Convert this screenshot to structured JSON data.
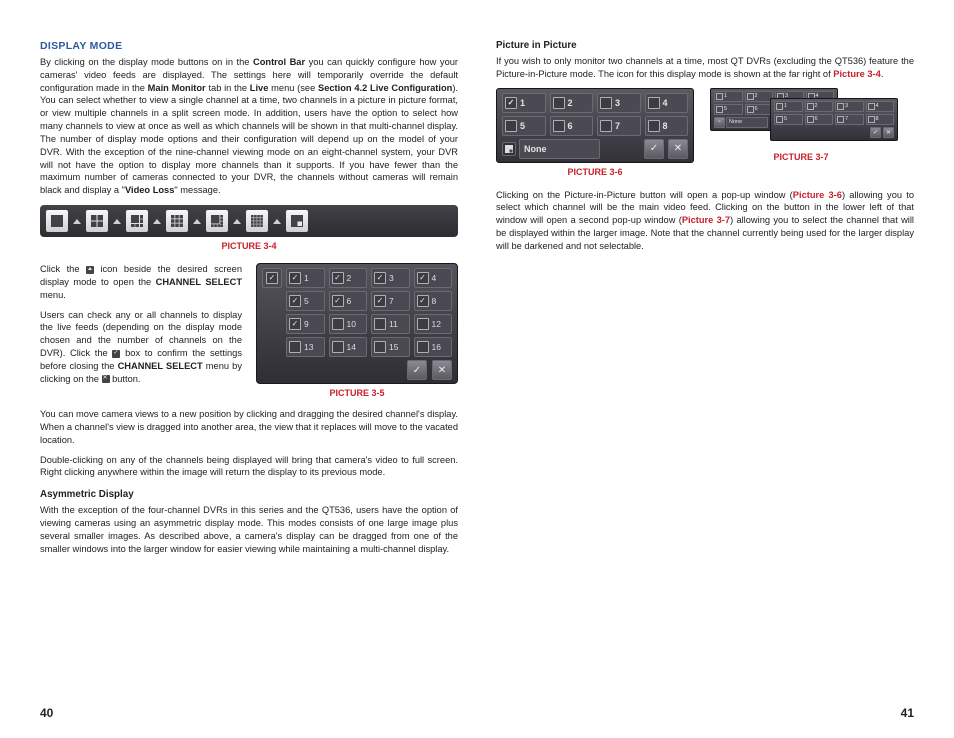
{
  "left": {
    "h1": "DISPLAY MODE",
    "p1a": "By clicking on the display mode buttons on in the ",
    "p1b": "Control Bar",
    "p1c": " you can quickly configure how your cameras' video feeds are displayed. The settings here will temporarily override the default configuration made in the ",
    "p1d": "Main Monitor",
    "p1e": " tab in the ",
    "p1f": "Live",
    "p1g": " menu (see ",
    "p1h": "Section 4.2 Live Configuration",
    "p1i": "). You can select whether to view a single channel at a time, two channels in a picture in picture format, or view multiple channels in a split screen mode. In addition, users have the option to select how many channels to view at once as well as which channels will be shown in that multi-channel display. The number of display mode options and their configuration will depend up on the model of your DVR. With the exception of the nine-channel viewing mode on an eight-channel system, your DVR will not have the option to display more channels than it supports. If you have fewer than the maximum number of cameras connected to your DVR, the channels without cameras will remain black and display a \"",
    "p1j": "Video Loss",
    "p1k": "\" message.",
    "pic34": "PICTURE 3-4",
    "p2a": "Click the ",
    "p2b": " icon beside the desired screen display mode to open the ",
    "p2c": "CHANNEL SELECT",
    "p2d": " menu.",
    "p3a": "Users can check any or all channels  to display the live feeds (depending on the display mode chosen and the number of channels on the DVR). Click the ",
    "p3b": " box to confirm the settings before closing the ",
    "p3c": "CHANNEL SELECT",
    "p3d": " menu by clicking on the ",
    "p3e": " button.",
    "pic35": "PICTURE 3-5",
    "p4": "You can move camera views to a new position by clicking and dragging the desired channel's display. When a channel's view is dragged into another area, the view that it replaces will move to the vacated location.",
    "p5": "Double-clicking on any of the channels being displayed will bring that camera's video to full screen. Right clicking anywhere within the image will return the display to its previous mode.",
    "h2": "Asymmetric Display",
    "p6": "With the exception of the four-channel DVRs in this series and the QT536, users have the option of viewing cameras using an asymmetric display mode. This modes consists of one large image plus several smaller images. As described above, a camera's display can be dragged from one of the smaller windows into the larger window for easier viewing while maintaining a multi-channel display."
  },
  "right": {
    "h1": "Picture in Picture",
    "p1a": "If you wish to only monitor two channels at a time, most QT DVRs (excluding the QT536) feature the Picture-in-Picture mode. The icon for this display mode is shown at the far right of ",
    "p1b": "Picture 3-4",
    "p1c": ".",
    "pic36": "PICTURE 3-6",
    "pic37": "PICTURE 3-7",
    "p2a": "Clicking on the Picture-in-Picture button will open a pop-up window (",
    "p2b": "Picture 3-6",
    "p2c": ") allowing you to select which channel will be the main video feed. Clicking on the button in the lower left of that window will open a second pop-up window (",
    "p2d": "Picture 3-7",
    "p2e": ") allowing you to select the channel that will be displayed within the larger image. Note that the channel currently being used for the larger display will be darkened and not selectable."
  },
  "chs": {
    "rows": [
      [
        {
          "n": "1",
          "on": true
        },
        {
          "n": "2",
          "on": true
        },
        {
          "n": "3",
          "on": true
        },
        {
          "n": "4",
          "on": true
        }
      ],
      [
        {
          "n": "5",
          "on": true
        },
        {
          "n": "6",
          "on": true
        },
        {
          "n": "7",
          "on": true
        },
        {
          "n": "8",
          "on": true
        }
      ],
      [
        {
          "n": "9",
          "on": true
        },
        {
          "n": "10",
          "on": false
        },
        {
          "n": "11",
          "on": false
        },
        {
          "n": "12",
          "on": false
        }
      ],
      [
        {
          "n": "13",
          "on": false
        },
        {
          "n": "14",
          "on": false
        },
        {
          "n": "15",
          "on": false
        },
        {
          "n": "16",
          "on": false
        }
      ]
    ]
  },
  "pip36": {
    "rows": [
      [
        "1",
        "2",
        "3",
        "4"
      ],
      [
        "5",
        "6",
        "7",
        "8"
      ]
    ],
    "none": "None"
  },
  "pip37": {
    "rows": [
      [
        "1",
        "2",
        "3",
        "4"
      ],
      [
        "5",
        "6",
        "7",
        "8"
      ]
    ],
    "none": "None"
  },
  "pn": {
    "left": "40",
    "right": "41"
  }
}
